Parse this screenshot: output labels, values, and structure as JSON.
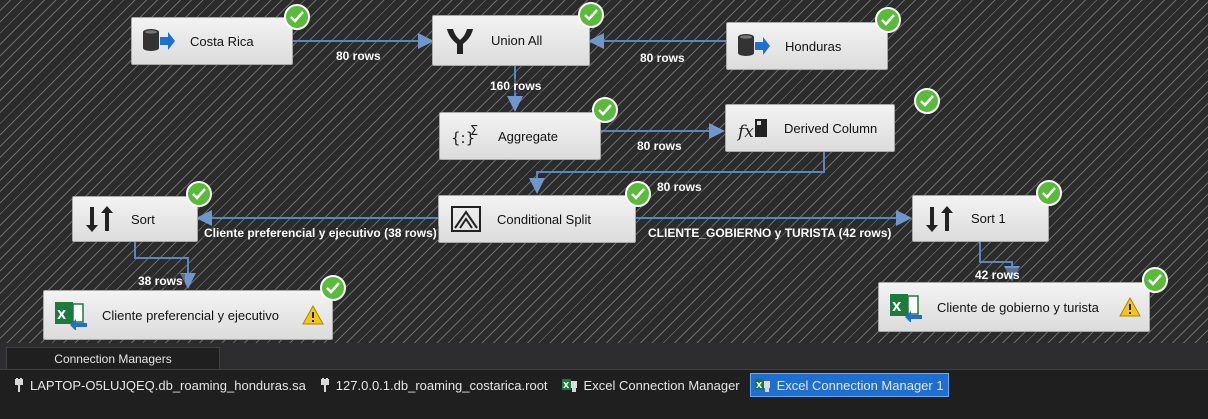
{
  "canvas": {
    "components": [
      {
        "id": "costa_rica",
        "label": "Costa Rica",
        "icon": "database-source-icon"
      },
      {
        "id": "union_all",
        "label": "Union All",
        "icon": "union-all-icon"
      },
      {
        "id": "honduras",
        "label": "Honduras",
        "icon": "database-source-icon"
      },
      {
        "id": "aggregate",
        "label": "Aggregate",
        "icon": "aggregate-icon"
      },
      {
        "id": "derived_column",
        "label": "Derived Column",
        "icon": "derived-column-icon"
      },
      {
        "id": "sort",
        "label": "Sort",
        "icon": "sort-icon"
      },
      {
        "id": "conditional_split",
        "label": "Conditional Split",
        "icon": "conditional-split-icon"
      },
      {
        "id": "sort1",
        "label": "Sort 1",
        "icon": "sort-icon"
      },
      {
        "id": "dest_pref",
        "label": "Cliente preferencial y ejecutivo",
        "icon": "excel-destination-icon",
        "warning": true
      },
      {
        "id": "dest_gob",
        "label": "Cliente de gobierno y turista",
        "icon": "excel-destination-icon",
        "warning": true
      }
    ],
    "path_labels": [
      {
        "id": "cr_union",
        "text": "80 rows"
      },
      {
        "id": "hn_union",
        "text": "80 rows"
      },
      {
        "id": "union_agg",
        "text": "160 rows"
      },
      {
        "id": "agg_derived",
        "text": "80 rows"
      },
      {
        "id": "derived_split",
        "text": "80 rows"
      },
      {
        "id": "split_sort",
        "text": "Cliente preferencial y ejecutivo (38 rows)"
      },
      {
        "id": "split_sort1",
        "text": "CLIENTE_GOBIERNO y TURISTA (42 rows)"
      },
      {
        "id": "sort_dest",
        "text": "38 rows"
      },
      {
        "id": "sort1_dest",
        "text": "42 rows"
      }
    ],
    "colors": {
      "success": "#5aba3c",
      "wire": "#5a86c0",
      "warning": "#f5c518"
    }
  },
  "bottom_panel": {
    "tab_label": "Connection Managers",
    "connections": [
      {
        "label": "LAPTOP-O5LUJQEQ.db_roaming_honduras.sa",
        "icon": "oledb-connection-icon",
        "selected": false
      },
      {
        "label": "127.0.0.1.db_roaming_costarica.root",
        "icon": "oledb-connection-icon",
        "selected": false
      },
      {
        "label": "Excel Connection Manager",
        "icon": "excel-connection-icon",
        "selected": false
      },
      {
        "label": "Excel Connection Manager 1",
        "icon": "excel-connection-icon",
        "selected": true
      }
    ]
  }
}
